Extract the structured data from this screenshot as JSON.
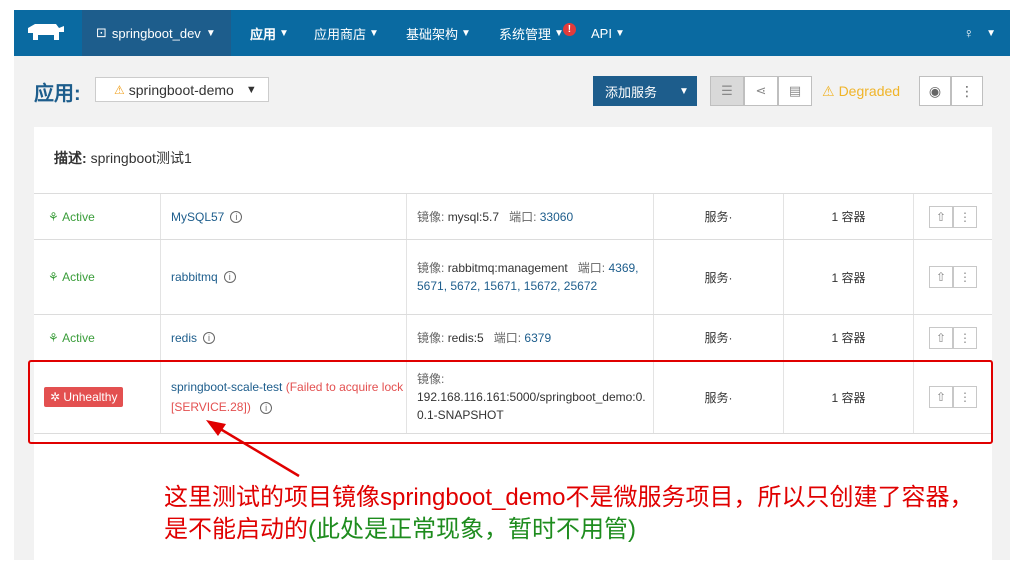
{
  "nav": {
    "env": "springboot_dev",
    "items": [
      {
        "label": "应用",
        "active": true
      },
      {
        "label": "应用商店"
      },
      {
        "label": "基础架构"
      },
      {
        "label": "系统管理"
      },
      {
        "label": "API"
      }
    ]
  },
  "header": {
    "title": "应用:",
    "stack_name": "springboot-demo",
    "add_service": "添加服务",
    "state": "Degraded"
  },
  "description": {
    "label": "描述:",
    "text": "springboot测试1"
  },
  "rows": [
    {
      "state": "Active",
      "name": "MySQL57",
      "error": "",
      "image_label": "镜像:",
      "image": "mysql:5.7",
      "port_label": "端口:",
      "ports": "33060",
      "service": "服务·",
      "containers": "1 容器"
    },
    {
      "state": "Active",
      "name": "rabbitmq",
      "error": "",
      "image_label": "镜像:",
      "image": "rabbitmq:management",
      "port_label": "端口:",
      "ports": "4369, 5671, 5672, 15671, 15672, 25672",
      "service": "服务·",
      "containers": "1 容器"
    },
    {
      "state": "Active",
      "name": "redis",
      "error": "",
      "image_label": "镜像:",
      "image": "redis:5",
      "port_label": "端口:",
      "ports": "6379",
      "service": "服务·",
      "containers": "1 容器"
    },
    {
      "state": "Unhealthy",
      "name": "springboot-scale-test",
      "error": "(Failed to acquire lock [SERVICE.28])",
      "image_label": "镜像:",
      "image": "192.168.116.161:5000/springboot_demo:0.0.1-SNAPSHOT",
      "port_label": "",
      "ports": "",
      "service": "服务·",
      "containers": "1 容器"
    }
  ],
  "annotation": {
    "text_red": "这里测试的项目镜像springboot_demo不是微服务项目，所以只创建了容器，是不能启动的",
    "text_green": "(此处是正常现象，暂时不用管)"
  },
  "colors": {
    "nav": "#0a6aa1",
    "primary": "#1d5d8c",
    "active": "#3a9d3a",
    "danger": "#e35050",
    "warning": "#f0b429",
    "annotation": "#e00000"
  }
}
